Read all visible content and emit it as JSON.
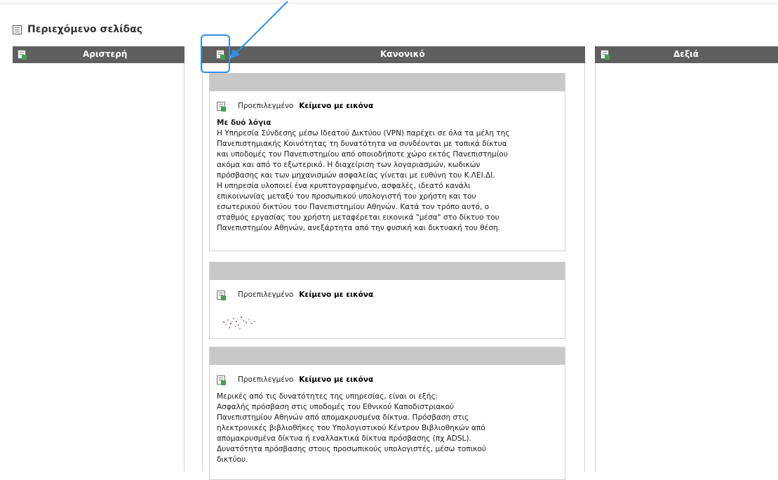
{
  "page": {
    "title": "Περιεχόμενο σελίδας"
  },
  "columns": [
    {
      "name": "Αριστερή"
    },
    {
      "name": "Κανονικό"
    },
    {
      "name": "Δεξιά"
    }
  ],
  "blocks": [
    {
      "kind_label": "Προεπιλεγμένο",
      "kind_value": "Κείμενο με εικόνα",
      "heading": "Με δυό λόγια",
      "lines": [
        "Η Υπηρεσία Σύνδεσης μέσω Ιδεατού Δικτύου (VPN) παρέχει σε όλα τα μέλη της",
        "Πανεπιστημιακής Κοινότητας τη δυνατότητα να συνδέονται με τοπικά δίκτυα",
        "και υποδομές του Πανεπιστημίου από οποιοδήποτε χώρο εκτός Πανεπιστημίου",
        "ακόμα και από το εξωτερικό. Η διαχείριση των λογαριασμών, κωδικών",
        "πρόσβασης και των μηχανισμών ασφαλείας γίνεται με ευθύνη του Κ.ΛΕΙ.ΔΙ.",
        "Η υπηρεσία υλοποιεί ένα κρυπτογραφημένο, ασφαλές, ιδεατό κανάλι",
        "επικοινωνίας μεταξύ του προσωπικού υπολογιστή του χρήστη και του",
        "εσωτερικού δικτύου του Πανεπιστημίου Αθηνών. Κατά τον τρόπο αυτό, ο",
        "σταθμός εργασίας του χρήστη μεταφέρεται εικονικά \"μέσα\" στο δίκτυο του",
        "Πανεπιστημίου Αθηνών, ανεξάρτητα από την φυσική και δικτυακή του θέση."
      ]
    },
    {
      "kind_label": "Προεπιλεγμένο",
      "kind_value": "Κείμενο με εικόνα"
    },
    {
      "kind_label": "Προεπιλεγμένο",
      "kind_value": "Κείμενο με εικόνα",
      "lines": [
        "Μερικές από τις δυνατότητες της υπηρεσίας, είναι οι εξής:",
        "Ασφαλής πρόσβαση στις υποδομές του Εθνικού Καποδιστριακού",
        "Πανεπιστημίου Αθηνών από απομακρυσμένα δίκτυα. Πρόσβαση στις",
        "ηλεκτρονικές βιβλιοθήκες του Υπολογιστικού Κέντρου Βιβλιοθηκών από",
        "απομακρυσμένα δίκτυα ή εναλλακτικά δίκτυα πρόσβασης (πχ ADSL).",
        "Δυνατότητα πρόσβασης στους προσωπικούς υπολογιστές, μέσω τοπικού",
        "δικτύου."
      ]
    }
  ],
  "colors": {
    "header_bg": "#5f5f5f",
    "block_bar": "#c8c8c8",
    "highlight": "#2f8ee8"
  }
}
